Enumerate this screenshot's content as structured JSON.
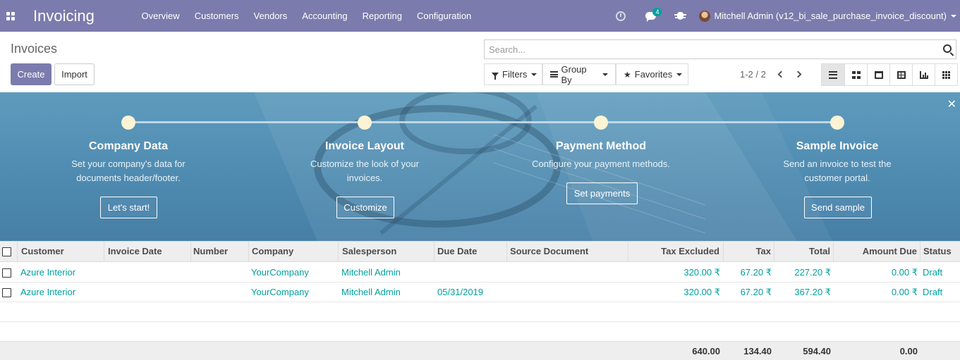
{
  "navbar": {
    "app_title": "Invoicing",
    "menu": [
      "Overview",
      "Customers",
      "Vendors",
      "Accounting",
      "Reporting",
      "Configuration"
    ],
    "messages_count": "4",
    "user_name": "Mitchell Admin (v12_bi_sale_purchase_invoice_discount)"
  },
  "control_panel": {
    "title": "Invoices",
    "create_label": "Create",
    "import_label": "Import",
    "search_placeholder": "Search...",
    "filters_label": "Filters",
    "group_by_label": "Group By",
    "favorites_label": "Favorites",
    "pager": "1-2 / 2",
    "views": [
      "list",
      "kanban",
      "calendar",
      "pivot",
      "graph",
      "grid"
    ]
  },
  "onboarding": {
    "steps": [
      {
        "title": "Company Data",
        "desc1": "Set your company's data for",
        "desc2": "documents header/footer.",
        "button": "Let's start!"
      },
      {
        "title": "Invoice Layout",
        "desc1": "Customize the look of your",
        "desc2": "invoices.",
        "button": "Customize"
      },
      {
        "title": "Payment Method",
        "desc1": "Configure your payment methods.",
        "desc2": "",
        "button": "Set payments"
      },
      {
        "title": "Sample Invoice",
        "desc1": "Send an invoice to test the",
        "desc2": "customer portal.",
        "button": "Send sample"
      }
    ]
  },
  "table": {
    "columns": [
      "Customer",
      "Invoice Date",
      "Number",
      "Company",
      "Salesperson",
      "Due Date",
      "Source Document",
      "Tax Excluded",
      "Tax",
      "Total",
      "Amount Due",
      "Status"
    ],
    "rows": [
      {
        "customer": "Azure Interior",
        "invoice_date": "",
        "number": "",
        "company": "YourCompany",
        "salesperson": "Mitchell Admin",
        "due_date": "",
        "source": "",
        "tax_excluded": "320.00 ₹",
        "tax": "67.20 ₹",
        "total": "227.20 ₹",
        "amount_due": "0.00 ₹",
        "status": "Draft"
      },
      {
        "customer": "Azure Interior",
        "invoice_date": "",
        "number": "",
        "company": "YourCompany",
        "salesperson": "Mitchell Admin",
        "due_date": "05/31/2019",
        "source": "",
        "tax_excluded": "320.00 ₹",
        "tax": "67.20 ₹",
        "total": "367.20 ₹",
        "amount_due": "0.00 ₹",
        "status": "Draft"
      }
    ],
    "totals": {
      "tax_excluded": "640.00",
      "tax": "134.40",
      "total": "594.40",
      "amount_due": "0.00"
    }
  },
  "colors": {
    "brand": "#7c7bad",
    "link": "#00a09d",
    "banner": "#4e8ab0"
  }
}
